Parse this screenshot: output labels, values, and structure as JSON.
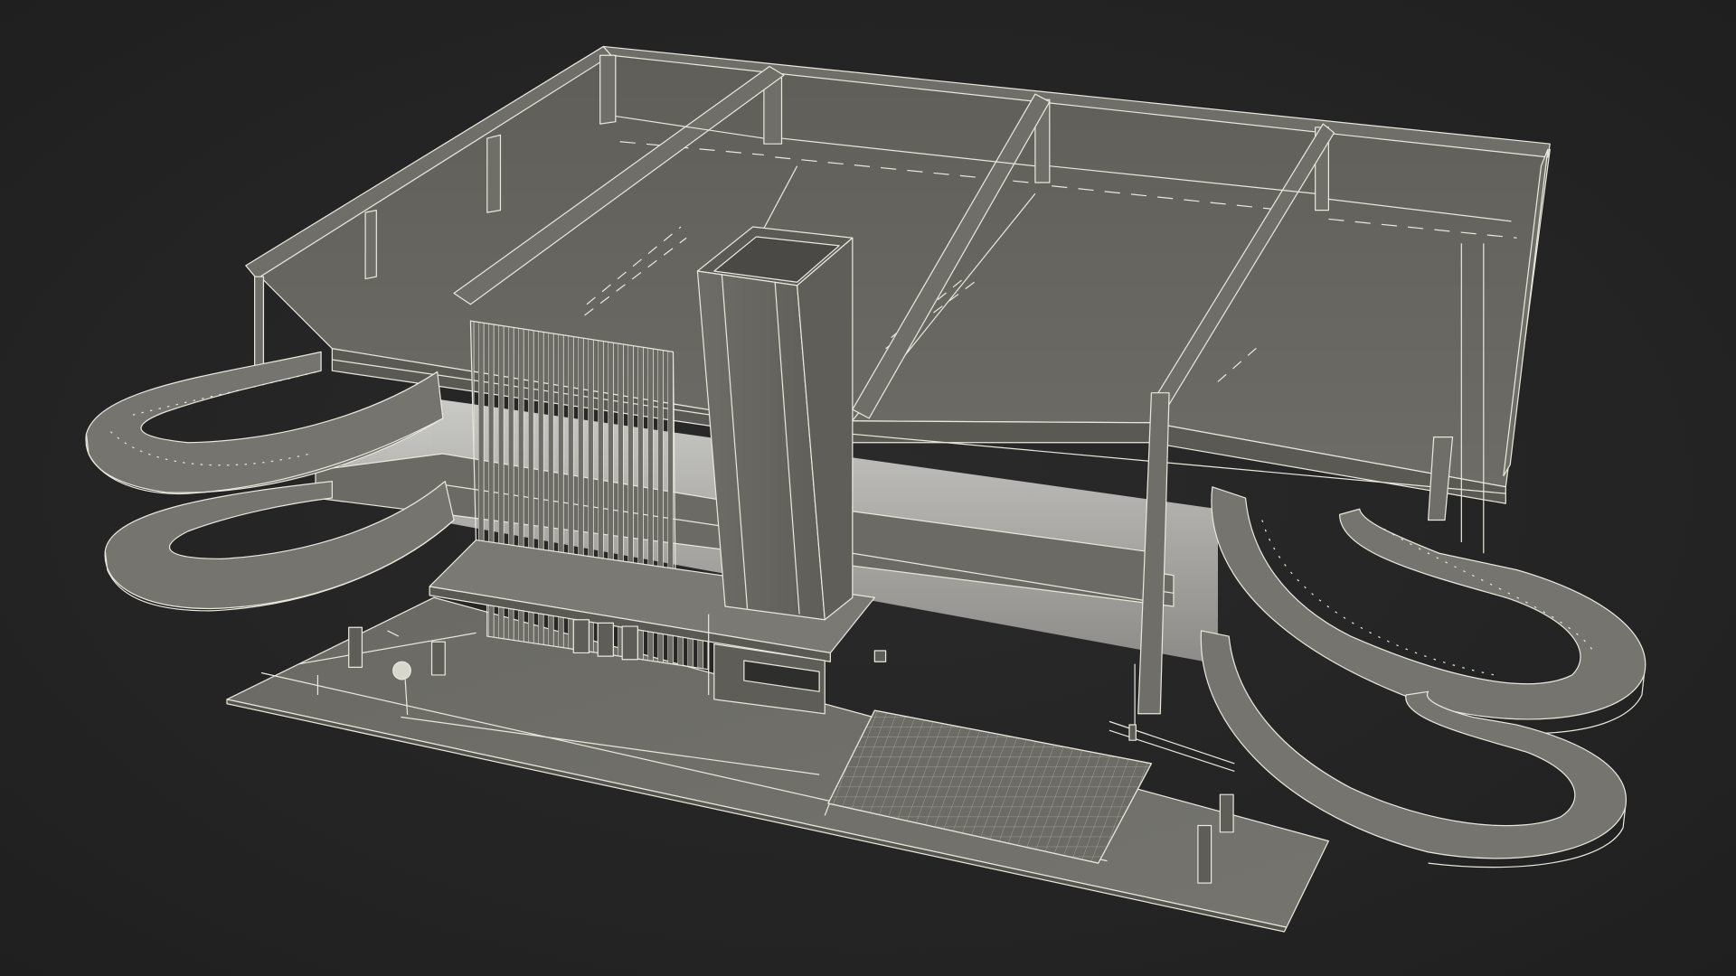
{
  "scene": {
    "subject": "parking-garage-wireframe-model",
    "background_color": "#262626",
    "model_fill_color": "#6f6e68",
    "wire_color": "#e9e8dc"
  }
}
